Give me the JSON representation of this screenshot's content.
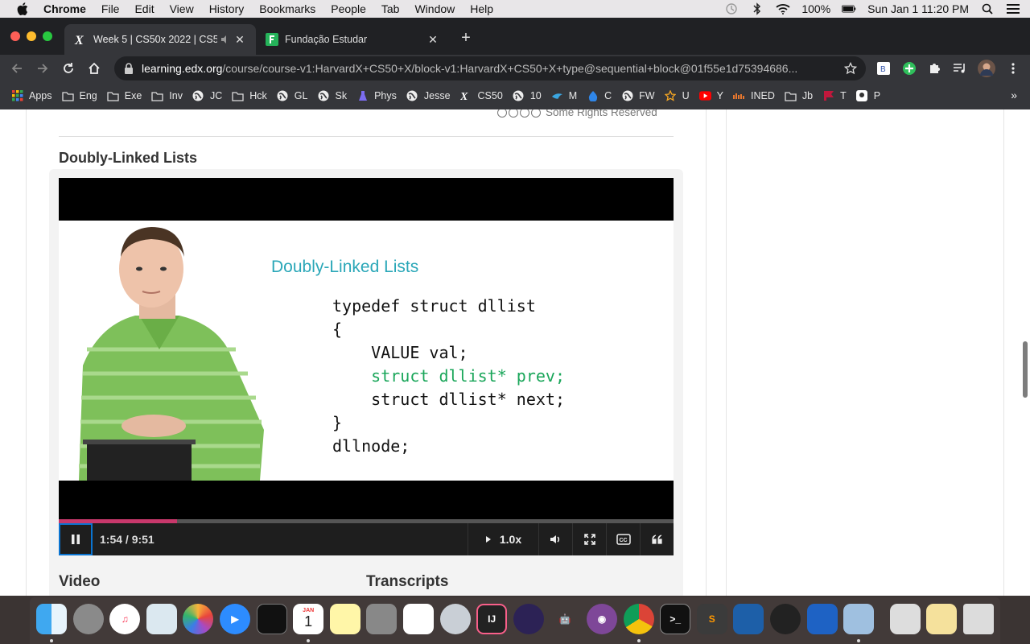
{
  "menubar": {
    "app_name": "Chrome",
    "items": [
      "File",
      "Edit",
      "View",
      "History",
      "Bookmarks",
      "People",
      "Tab",
      "Window",
      "Help"
    ],
    "battery": "100%",
    "datetime": "Sun Jan 1  11:20 PM"
  },
  "tabs": [
    {
      "title": "Week 5 | CS50x 2022 | CS50",
      "active": true
    },
    {
      "title": "Fundação Estudar",
      "active": false
    }
  ],
  "toolbar": {
    "url_host": "learning.edx.org",
    "url_path": "/course/course-v1:HarvardX+CS50+X/block-v1:HarvardX+CS50+X+type@sequential+block@01f55e1d75394686..."
  },
  "bookmarks": [
    {
      "label": "Apps",
      "icon": "apps-grid-icon"
    },
    {
      "label": "Eng",
      "icon": "folder-icon"
    },
    {
      "label": "Exe",
      "icon": "folder-icon"
    },
    {
      "label": "Inv",
      "icon": "folder-icon"
    },
    {
      "label": "JC",
      "icon": "globe-icon"
    },
    {
      "label": "Hck",
      "icon": "folder-icon"
    },
    {
      "label": "GL",
      "icon": "globe-icon"
    },
    {
      "label": "Sk",
      "icon": "globe-icon"
    },
    {
      "label": "Phys",
      "icon": "flask-icon"
    },
    {
      "label": "Jesse",
      "icon": "globe-icon"
    },
    {
      "label": "CS50",
      "icon": "edx-icon"
    },
    {
      "label": "10",
      "icon": "globe-icon"
    },
    {
      "label": "M",
      "icon": "bird-icon"
    },
    {
      "label": "C",
      "icon": "drop-icon"
    },
    {
      "label": "FW",
      "icon": "globe-icon"
    },
    {
      "label": "U",
      "icon": "star-icon"
    },
    {
      "label": "Y",
      "icon": "youtube-icon"
    },
    {
      "label": "INED",
      "icon": "ined-icon"
    },
    {
      "label": "Jb",
      "icon": "folder-icon"
    },
    {
      "label": "T",
      "icon": "flag-icon"
    },
    {
      "label": "P",
      "icon": "pocket-icon"
    }
  ],
  "page": {
    "rights_text": "Some Rights Reserved",
    "unit_title": "Doubly-Linked Lists",
    "video_heading": "Video",
    "transcripts_heading": "Transcripts"
  },
  "slide": {
    "title": "Doubly-Linked Lists",
    "code_lines": [
      "typedef struct dllist",
      "{",
      "    VALUE val;",
      "    struct dllist* prev;",
      "    struct dllist* next;",
      "}",
      "dllnode;"
    ],
    "highlight_color": "#1aa65a",
    "title_color": "#2aa7b8"
  },
  "player": {
    "time": "1:54 / 9:51",
    "progress_fraction": 0.193,
    "speed": "1.0x",
    "progress_color": "#c8386b"
  },
  "dock": {
    "apps": [
      "finder",
      "system-preferences",
      "music",
      "preview",
      "photos",
      "zoom",
      "activity-monitor",
      "calendar",
      "notes",
      "calculator",
      "reminders",
      "launchpad",
      "intellij",
      "eclipse",
      "android-studio",
      "tor-browser",
      "chrome",
      "terminal",
      "sublime-text",
      "virtualbox",
      "davinci",
      "remote-desktop",
      "image-viewer",
      "file-archive",
      "document",
      "trash"
    ],
    "calendar_month": "JAN",
    "calendar_day": "1"
  }
}
